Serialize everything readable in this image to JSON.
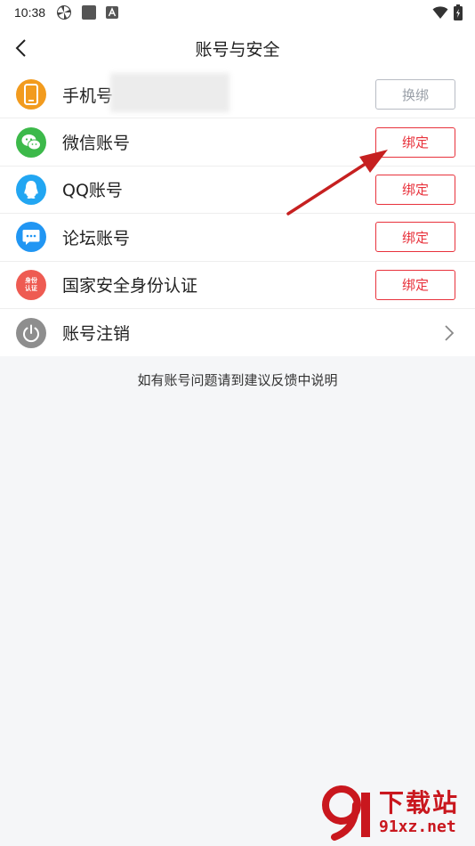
{
  "status_bar": {
    "time": "10:38",
    "left_icons": [
      "pinwheel-icon",
      "square-icon",
      "a-icon"
    ],
    "right_icons": [
      "wifi-icon",
      "battery-icon"
    ]
  },
  "header": {
    "title": "账号与安全",
    "back_icon": "chevron-left-icon"
  },
  "rows": [
    {
      "label": "手机号",
      "icon": "phone-icon",
      "icon_color": "#f29b1e",
      "button": "换绑",
      "button_style": "grey"
    },
    {
      "label": "微信账号",
      "icon": "wechat-icon",
      "icon_color": "#3cb94a",
      "button": "绑定",
      "button_style": "red"
    },
    {
      "label": "QQ账号",
      "icon": "qq-icon",
      "icon_color": "#22a6f2",
      "button": "绑定",
      "button_style": "red"
    },
    {
      "label": "论坛账号",
      "icon": "forum-chat-icon",
      "icon_color": "#2196f3",
      "button": "绑定",
      "button_style": "red"
    },
    {
      "label": "国家安全身份认证",
      "icon": "id-verify-icon",
      "icon_color": "#ee5b52",
      "icon_text_1": "身份",
      "icon_text_2": "认证",
      "button": "绑定",
      "button_style": "red"
    },
    {
      "label": "账号注销",
      "icon": "power-icon",
      "icon_color": "#8e8e8e",
      "trailing": "chevron-right-icon"
    }
  ],
  "hint": "如有账号问题请到建议反馈中说明",
  "watermark": {
    "title": "下载站",
    "url": "91xz.net"
  },
  "colors": {
    "accent_red": "#e8323c",
    "grey_button": "#9aa0a8",
    "background": "#f5f6f8"
  }
}
